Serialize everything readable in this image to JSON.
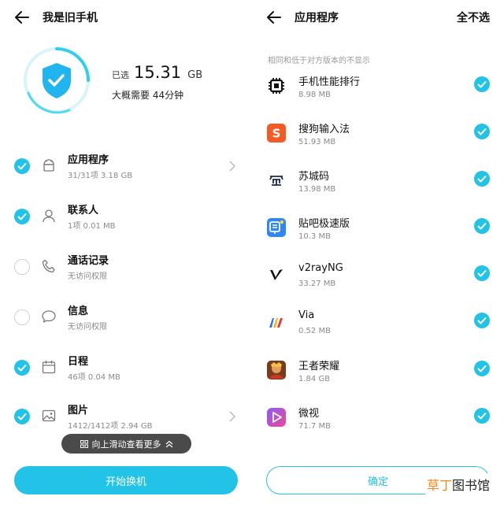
{
  "colors": {
    "accent": "#22c3e6",
    "text": "#111111",
    "muted": "#8a8a8a",
    "hint_bg": "#4a4a4a"
  },
  "left": {
    "title": "我是旧手机",
    "selected_label": "已选",
    "selected_value": "15.31",
    "selected_unit": "GB",
    "eta": "大概需要 44分钟",
    "categories": [
      {
        "name": "应用程序",
        "sub": "31/31项  3.18 GB",
        "checked": true,
        "icon": "android-icon",
        "chevron": true
      },
      {
        "name": "联系人",
        "sub": "1项  0.01 MB",
        "checked": true,
        "icon": "person-icon",
        "chevron": false
      },
      {
        "name": "通话记录",
        "sub": "无访问权限",
        "checked": false,
        "icon": "phone-icon",
        "chevron": false
      },
      {
        "name": "信息",
        "sub": "无访问权限",
        "checked": false,
        "icon": "chat-icon",
        "chevron": false
      },
      {
        "name": "日程",
        "sub": "46项  0.04 MB",
        "checked": true,
        "icon": "calendar-icon",
        "chevron": false
      },
      {
        "name": "图片",
        "sub": "1412/1412项  2.94 GB",
        "checked": true,
        "icon": "image-icon",
        "chevron": true
      }
    ],
    "scroll_hint": "向上滑动查看更多",
    "start_button": "开始换机"
  },
  "right": {
    "title": "应用程序",
    "deselect_all": "全不选",
    "note": "相同和低于对方版本的不显示",
    "apps": [
      {
        "name": "手机性能排行",
        "size": "8.98 MB",
        "checked": true,
        "icon": "chip-icon"
      },
      {
        "name": "搜狗输入法",
        "size": "51.93 MB",
        "checked": true,
        "icon": "sogou-icon"
      },
      {
        "name": "苏城码",
        "size": "13.98 MB",
        "checked": true,
        "icon": "sucheng-icon"
      },
      {
        "name": "贴吧极速版",
        "size": "10.3 MB",
        "checked": true,
        "icon": "tieba-icon"
      },
      {
        "name": "v2rayNG",
        "size": "33.27 MB",
        "checked": true,
        "icon": "v2ray-icon"
      },
      {
        "name": "Via",
        "size": "0.52 MB",
        "checked": true,
        "icon": "via-icon"
      },
      {
        "name": "王者荣耀",
        "size": "1.84 GB",
        "checked": true,
        "icon": "game-icon"
      },
      {
        "name": "微视",
        "size": "71.7 MB",
        "checked": true,
        "icon": "weishi-icon"
      }
    ],
    "confirm_button": "确定"
  },
  "watermark": {
    "part1": "草丁",
    "part2": "图书馆"
  }
}
